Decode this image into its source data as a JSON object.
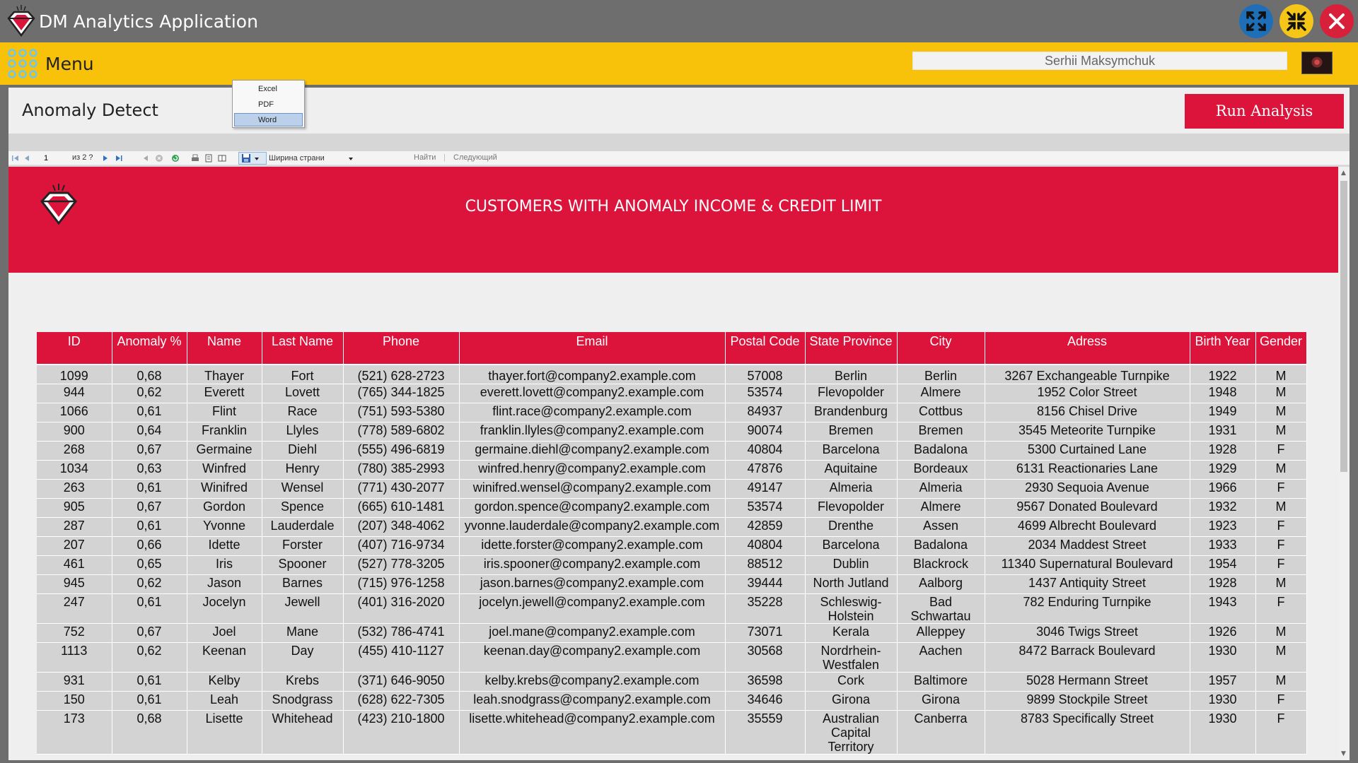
{
  "app": {
    "title": "DM Analytics Application",
    "colors": {
      "titlebar": "#6e6e6e",
      "menubar": "#f9c20a",
      "accent": "#dc143c"
    }
  },
  "window_controls": {
    "restore_icon": "expand-arrows-icon",
    "minimize_icon": "compress-arrows-icon",
    "close_icon": "close-icon"
  },
  "menubar": {
    "menu_label": "Menu",
    "user_name": "Serhii Maksymchuk"
  },
  "panel": {
    "title": "Anomaly Detect",
    "run_button": "Run Analysis"
  },
  "toolbar": {
    "page_number": "1",
    "page_of": "из 2 ?",
    "zoom": "Ширина страни",
    "find": "Найти",
    "next": "Следующий"
  },
  "export_menu": {
    "items": [
      "Excel",
      "PDF",
      "Word"
    ],
    "selected": "Word"
  },
  "report": {
    "title": "CUSTOMERS WITH ANOMALY INCOME & CREDIT LIMIT",
    "columns": [
      "ID",
      "Anomaly %",
      "Name",
      "Last Name",
      "Phone",
      "Email",
      "Postal Code",
      "State Province",
      "City",
      "Adress",
      "Birth Year",
      "Gender"
    ],
    "rows": [
      [
        "1099",
        "0,68",
        "Thayer",
        "Fort",
        "(521) 628-2723",
        "thayer.fort@company2.example.com",
        "57008",
        "Berlin",
        "Berlin",
        "3267 Exchangeable Turnpike",
        "1922",
        "M"
      ],
      [
        "944",
        "0,62",
        "Everett",
        "Lovett",
        "(765) 344-1825",
        "everett.lovett@company2.example.com",
        "53574",
        "Flevopolder",
        "Almere",
        "1952 Color Street",
        "1948",
        "M"
      ],
      [
        "1066",
        "0,61",
        "Flint",
        "Race",
        "(751) 593-5380",
        "flint.race@company2.example.com",
        "84937",
        "Brandenburg",
        "Cottbus",
        "8156 Chisel Drive",
        "1949",
        "M"
      ],
      [
        "900",
        "0,64",
        "Franklin",
        "Llyles",
        "(778) 589-6802",
        "franklin.llyles@company2.example.com",
        "90074",
        "Bremen",
        "Bremen",
        "3545 Meteorite Turnpike",
        "1931",
        "M"
      ],
      [
        "268",
        "0,67",
        "Germaine",
        "Diehl",
        "(555) 496-6819",
        "germaine.diehl@company2.example.com",
        "40804",
        "Barcelona",
        "Badalona",
        "5300 Curtained Lane",
        "1928",
        "F"
      ],
      [
        "1034",
        "0,63",
        "Winfred",
        "Henry",
        "(780) 385-2993",
        "winfred.henry@company2.example.com",
        "47876",
        "Aquitaine",
        "Bordeaux",
        "6131 Reactionaries Lane",
        "1929",
        "M"
      ],
      [
        "263",
        "0,61",
        "Winifred",
        "Wensel",
        "(771) 430-2077",
        "winifred.wensel@company2.example.com",
        "49147",
        "Almeria",
        "Almeria",
        "2930 Sequoia Avenue",
        "1966",
        "F"
      ],
      [
        "905",
        "0,67",
        "Gordon",
        "Spence",
        "(665) 610-1481",
        "gordon.spence@company2.example.com",
        "53574",
        "Flevopolder",
        "Almere",
        "9567 Donated Boulevard",
        "1932",
        "M"
      ],
      [
        "287",
        "0,61",
        "Yvonne",
        "Lauderdale",
        "(207) 348-4062",
        "yvonne.lauderdale@company2.example.com",
        "42859",
        "Drenthe",
        "Assen",
        "4699 Albrecht Boulevard",
        "1923",
        "F"
      ],
      [
        "207",
        "0,66",
        "Idette",
        "Forster",
        "(407) 716-9734",
        "idette.forster@company2.example.com",
        "40804",
        "Barcelona",
        "Badalona",
        "2034 Maddest Street",
        "1933",
        "F"
      ],
      [
        "461",
        "0,65",
        "Iris",
        "Spooner",
        "(527) 778-3205",
        "iris.spooner@company2.example.com",
        "88512",
        "Dublin",
        "Blackrock",
        "11340 Supernatural Boulevard",
        "1954",
        "F"
      ],
      [
        "945",
        "0,62",
        "Jason",
        "Barnes",
        "(715) 976-1258",
        "jason.barnes@company2.example.com",
        "39444",
        "North Jutland",
        "Aalborg",
        "1437 Antiquity Street",
        "1928",
        "M"
      ],
      [
        "247",
        "0,61",
        "Jocelyn",
        "Jewell",
        "(401) 316-2020",
        "jocelyn.jewell@company2.example.com",
        "35228",
        "Schleswig-Holstein",
        "Bad Schwartau",
        "782 Enduring Turnpike",
        "1943",
        "F"
      ],
      [
        "752",
        "0,67",
        "Joel",
        "Mane",
        "(532) 786-4741",
        "joel.mane@company2.example.com",
        "73071",
        "Kerala",
        "Alleppey",
        "3046 Twigs Street",
        "1926",
        "M"
      ],
      [
        "1113",
        "0,62",
        "Keenan",
        "Day",
        "(455) 410-1127",
        "keenan.day@company2.example.com",
        "30568",
        "Nordrhein-Westfalen",
        "Aachen",
        "8472 Barrack Boulevard",
        "1930",
        "M"
      ],
      [
        "931",
        "0,61",
        "Kelby",
        "Krebs",
        "(371) 646-9050",
        "kelby.krebs@company2.example.com",
        "36598",
        "Cork",
        "Baltimore",
        "5028 Hermann Street",
        "1957",
        "M"
      ],
      [
        "150",
        "0,61",
        "Leah",
        "Snodgrass",
        "(628) 622-7305",
        "leah.snodgrass@company2.example.com",
        "34646",
        "Girona",
        "Girona",
        "9899 Stockpile Street",
        "1930",
        "F"
      ],
      [
        "173",
        "0,68",
        "Lisette",
        "Whitehead",
        "(423) 210-1800",
        "lisette.whitehead@company2.example.com",
        "35559",
        "Australian Capital Territory",
        "Canberra",
        "8783 Specifically Street",
        "1930",
        "F"
      ]
    ]
  }
}
